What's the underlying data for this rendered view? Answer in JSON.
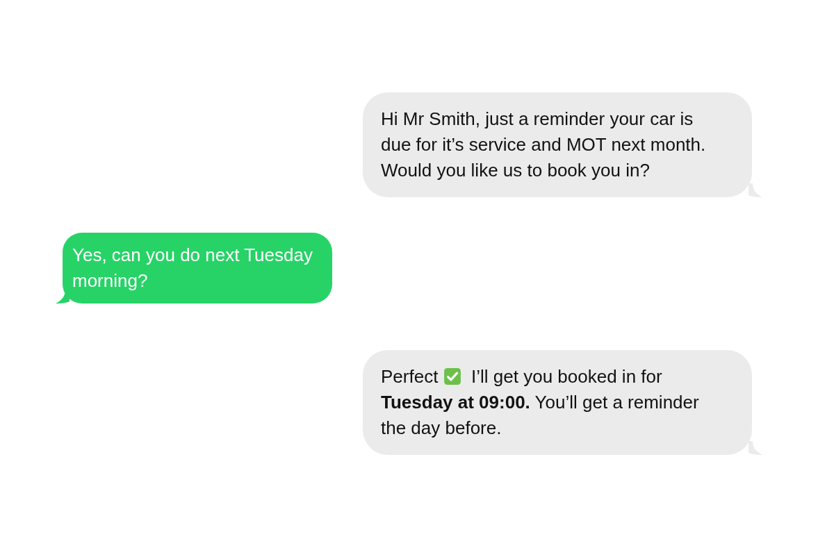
{
  "messages": [
    {
      "kind": "incoming",
      "text": "Hi Mr Smith, just a reminder your car is due for it’s service and MOT next month. Would you like us to book you in?"
    },
    {
      "kind": "outgoing",
      "text": "Yes, can you do next Tuesday morning?"
    },
    {
      "kind": "incoming",
      "lead": "Perfect",
      "check": true,
      "text": "I’ll get you booked in for **Tuesday at 09:00.** You’ll get a reminder the day before."
    }
  ]
}
